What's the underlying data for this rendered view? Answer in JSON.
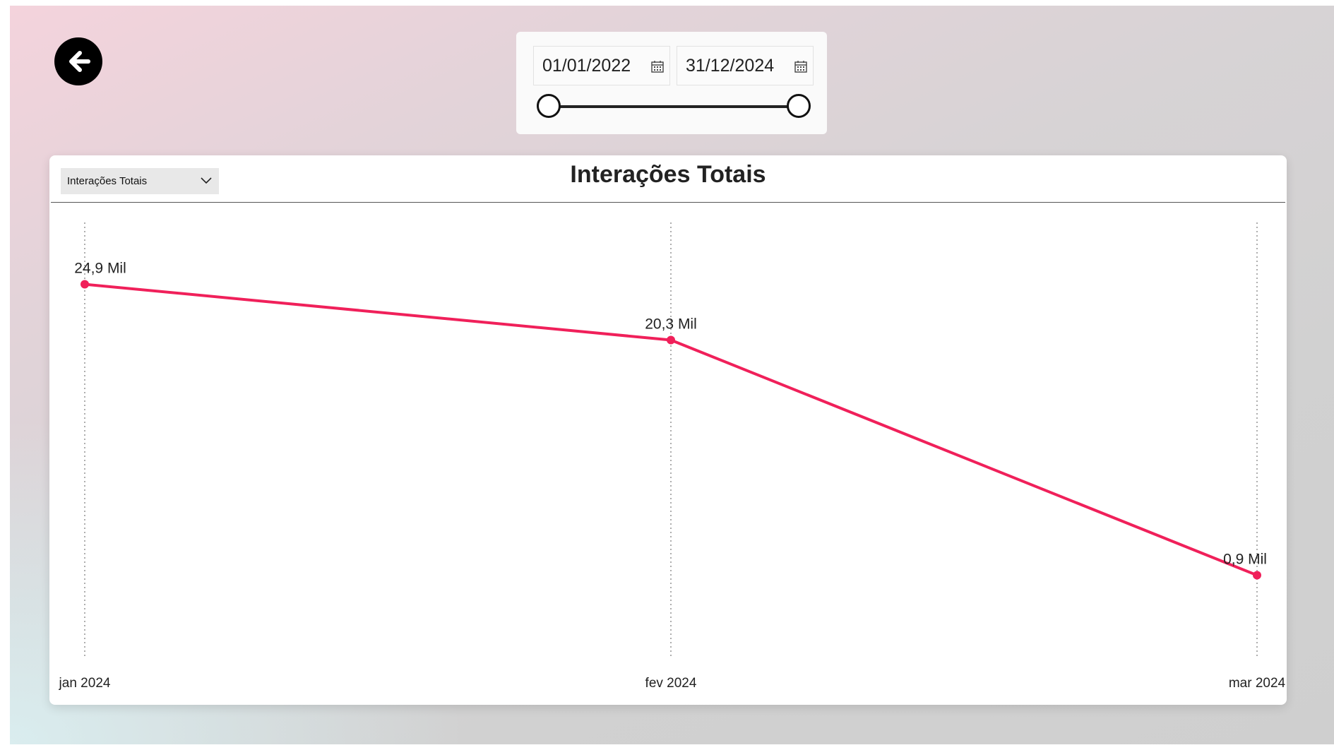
{
  "date_range": {
    "start": "01/01/2022",
    "end": "31/12/2024",
    "slider": {
      "start_fraction": 0,
      "end_fraction": 1
    }
  },
  "icons": {
    "back": "arrow-left-icon",
    "calendar": "calendar-icon",
    "dropdown": "chevron-down-icon"
  },
  "chart_card": {
    "dropdown_label": "Interações Totais",
    "title": "Interações Totais"
  },
  "chart_data": {
    "type": "line",
    "title": "Interações Totais",
    "categories": [
      "jan 2024",
      "fev 2024",
      "mar 2024"
    ],
    "series": [
      {
        "values": [
          24.9,
          20.3,
          0.9
        ],
        "labels": [
          "24,9 Mil",
          "20,3 Mil",
          "0,9 Mil"
        ],
        "color": "#f0205a"
      }
    ],
    "unit": "Mil",
    "ylim": [
      0,
      30
    ],
    "grid": "vertical-dotted",
    "legend": "none"
  },
  "colors": {
    "line": "#f0205a",
    "title": "#222222"
  }
}
